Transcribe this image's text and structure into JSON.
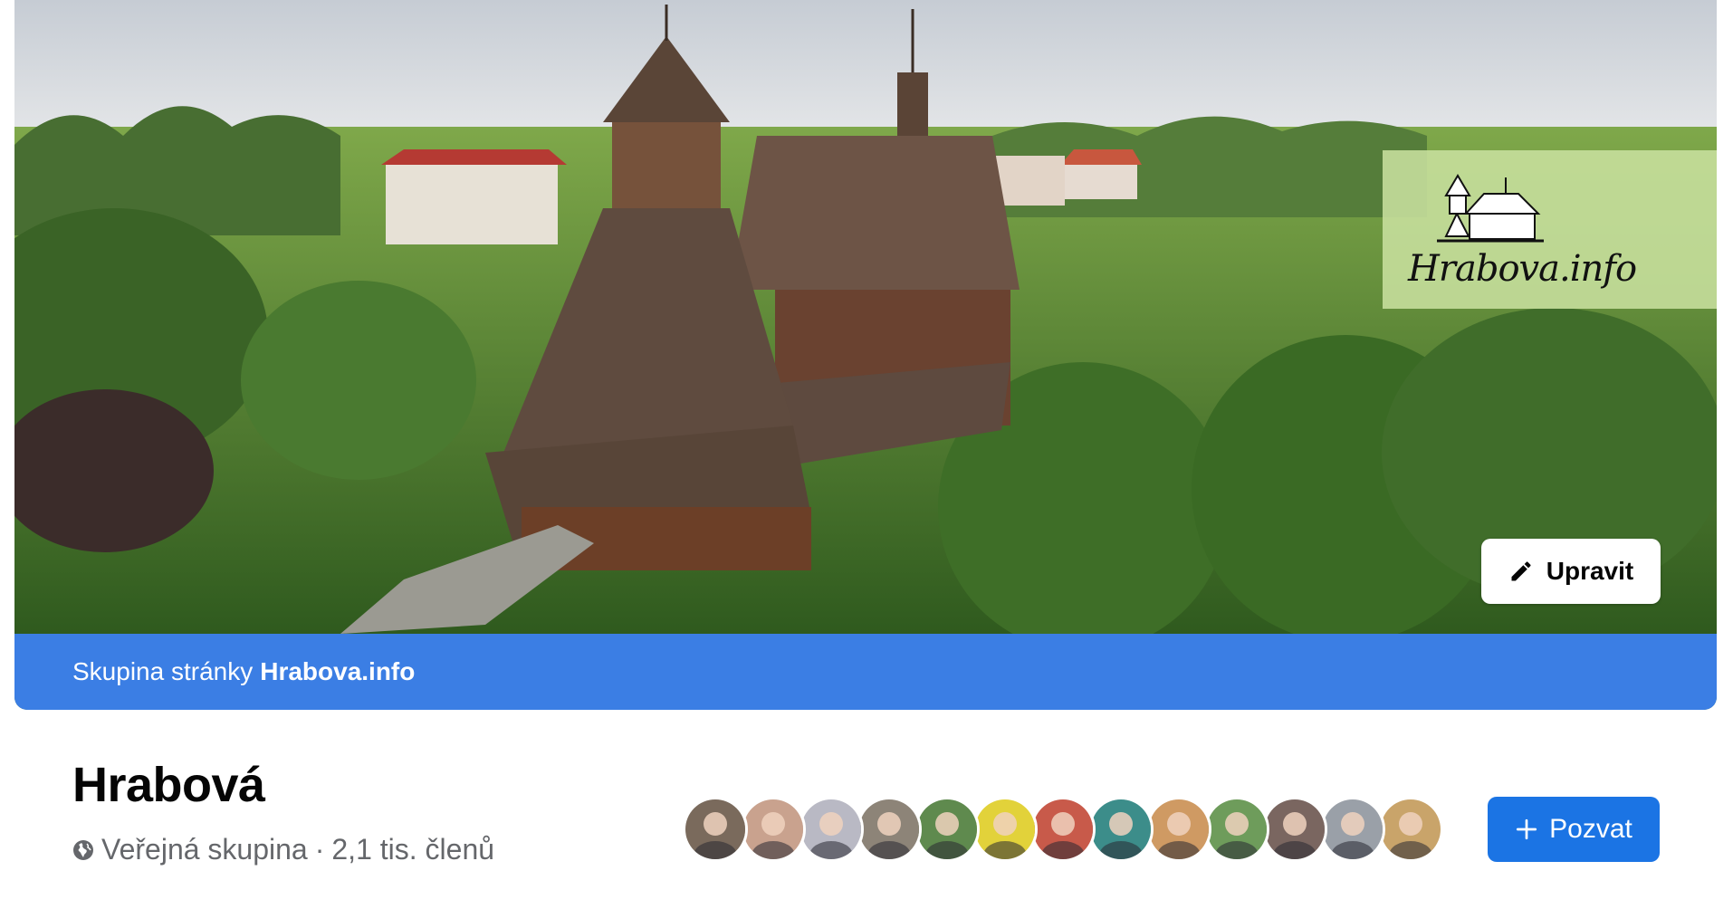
{
  "cover": {
    "logo_text": "Hrabova.info",
    "edit_label": "Upravit",
    "banner_prefix": "Skupina stránky",
    "banner_link": "Hrabova.info"
  },
  "group": {
    "title": "Hrabová",
    "privacy": "Veřejná skupina",
    "separator": "·",
    "members": "2,1 tis. členů"
  },
  "members_preview": {
    "avatar_colors": [
      "#7a6a5c",
      "#c9a28e",
      "#b9b9c4",
      "#8d8478",
      "#5f8a4e",
      "#e2d23a",
      "#c85a4a",
      "#3c8d8a",
      "#cf9a63",
      "#6e9c5b",
      "#7a6660",
      "#9aa0a8",
      "#c9a46a"
    ]
  },
  "actions": {
    "invite_label": "Pozvat"
  },
  "colors": {
    "banner": "#3b7ee4",
    "primary": "#1b74e4",
    "secondary_text": "#65676b"
  }
}
